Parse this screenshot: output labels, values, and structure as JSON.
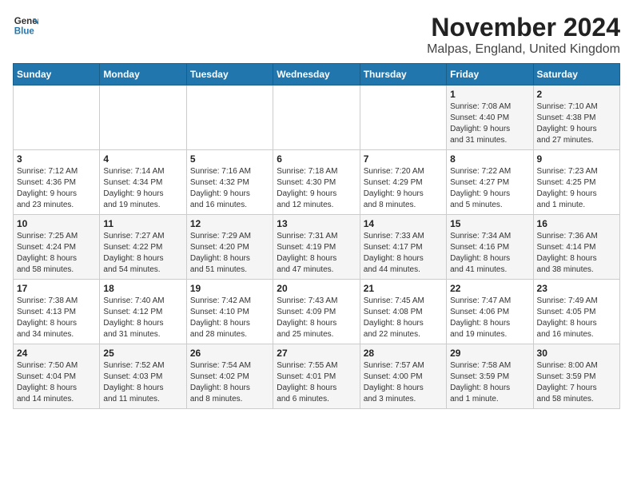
{
  "header": {
    "logo_line1": "General",
    "logo_line2": "Blue",
    "title": "November 2024",
    "subtitle": "Malpas, England, United Kingdom"
  },
  "columns": [
    "Sunday",
    "Monday",
    "Tuesday",
    "Wednesday",
    "Thursday",
    "Friday",
    "Saturday"
  ],
  "weeks": [
    [
      {
        "day": "",
        "info": ""
      },
      {
        "day": "",
        "info": ""
      },
      {
        "day": "",
        "info": ""
      },
      {
        "day": "",
        "info": ""
      },
      {
        "day": "",
        "info": ""
      },
      {
        "day": "1",
        "info": "Sunrise: 7:08 AM\nSunset: 4:40 PM\nDaylight: 9 hours\nand 31 minutes."
      },
      {
        "day": "2",
        "info": "Sunrise: 7:10 AM\nSunset: 4:38 PM\nDaylight: 9 hours\nand 27 minutes."
      }
    ],
    [
      {
        "day": "3",
        "info": "Sunrise: 7:12 AM\nSunset: 4:36 PM\nDaylight: 9 hours\nand 23 minutes."
      },
      {
        "day": "4",
        "info": "Sunrise: 7:14 AM\nSunset: 4:34 PM\nDaylight: 9 hours\nand 19 minutes."
      },
      {
        "day": "5",
        "info": "Sunrise: 7:16 AM\nSunset: 4:32 PM\nDaylight: 9 hours\nand 16 minutes."
      },
      {
        "day": "6",
        "info": "Sunrise: 7:18 AM\nSunset: 4:30 PM\nDaylight: 9 hours\nand 12 minutes."
      },
      {
        "day": "7",
        "info": "Sunrise: 7:20 AM\nSunset: 4:29 PM\nDaylight: 9 hours\nand 8 minutes."
      },
      {
        "day": "8",
        "info": "Sunrise: 7:22 AM\nSunset: 4:27 PM\nDaylight: 9 hours\nand 5 minutes."
      },
      {
        "day": "9",
        "info": "Sunrise: 7:23 AM\nSunset: 4:25 PM\nDaylight: 9 hours\nand 1 minute."
      }
    ],
    [
      {
        "day": "10",
        "info": "Sunrise: 7:25 AM\nSunset: 4:24 PM\nDaylight: 8 hours\nand 58 minutes."
      },
      {
        "day": "11",
        "info": "Sunrise: 7:27 AM\nSunset: 4:22 PM\nDaylight: 8 hours\nand 54 minutes."
      },
      {
        "day": "12",
        "info": "Sunrise: 7:29 AM\nSunset: 4:20 PM\nDaylight: 8 hours\nand 51 minutes."
      },
      {
        "day": "13",
        "info": "Sunrise: 7:31 AM\nSunset: 4:19 PM\nDaylight: 8 hours\nand 47 minutes."
      },
      {
        "day": "14",
        "info": "Sunrise: 7:33 AM\nSunset: 4:17 PM\nDaylight: 8 hours\nand 44 minutes."
      },
      {
        "day": "15",
        "info": "Sunrise: 7:34 AM\nSunset: 4:16 PM\nDaylight: 8 hours\nand 41 minutes."
      },
      {
        "day": "16",
        "info": "Sunrise: 7:36 AM\nSunset: 4:14 PM\nDaylight: 8 hours\nand 38 minutes."
      }
    ],
    [
      {
        "day": "17",
        "info": "Sunrise: 7:38 AM\nSunset: 4:13 PM\nDaylight: 8 hours\nand 34 minutes."
      },
      {
        "day": "18",
        "info": "Sunrise: 7:40 AM\nSunset: 4:12 PM\nDaylight: 8 hours\nand 31 minutes."
      },
      {
        "day": "19",
        "info": "Sunrise: 7:42 AM\nSunset: 4:10 PM\nDaylight: 8 hours\nand 28 minutes."
      },
      {
        "day": "20",
        "info": "Sunrise: 7:43 AM\nSunset: 4:09 PM\nDaylight: 8 hours\nand 25 minutes."
      },
      {
        "day": "21",
        "info": "Sunrise: 7:45 AM\nSunset: 4:08 PM\nDaylight: 8 hours\nand 22 minutes."
      },
      {
        "day": "22",
        "info": "Sunrise: 7:47 AM\nSunset: 4:06 PM\nDaylight: 8 hours\nand 19 minutes."
      },
      {
        "day": "23",
        "info": "Sunrise: 7:49 AM\nSunset: 4:05 PM\nDaylight: 8 hours\nand 16 minutes."
      }
    ],
    [
      {
        "day": "24",
        "info": "Sunrise: 7:50 AM\nSunset: 4:04 PM\nDaylight: 8 hours\nand 14 minutes."
      },
      {
        "day": "25",
        "info": "Sunrise: 7:52 AM\nSunset: 4:03 PM\nDaylight: 8 hours\nand 11 minutes."
      },
      {
        "day": "26",
        "info": "Sunrise: 7:54 AM\nSunset: 4:02 PM\nDaylight: 8 hours\nand 8 minutes."
      },
      {
        "day": "27",
        "info": "Sunrise: 7:55 AM\nSunset: 4:01 PM\nDaylight: 8 hours\nand 6 minutes."
      },
      {
        "day": "28",
        "info": "Sunrise: 7:57 AM\nSunset: 4:00 PM\nDaylight: 8 hours\nand 3 minutes."
      },
      {
        "day": "29",
        "info": "Sunrise: 7:58 AM\nSunset: 3:59 PM\nDaylight: 8 hours\nand 1 minute."
      },
      {
        "day": "30",
        "info": "Sunrise: 8:00 AM\nSunset: 3:59 PM\nDaylight: 7 hours\nand 58 minutes."
      }
    ]
  ]
}
